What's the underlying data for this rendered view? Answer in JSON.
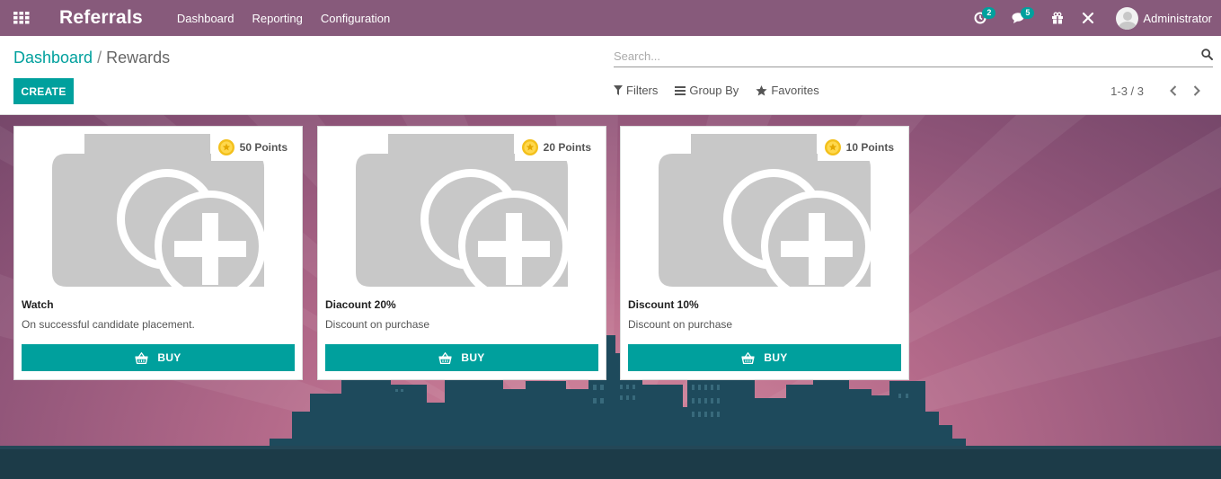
{
  "app": {
    "title": "Referrals"
  },
  "menu": [
    {
      "label": "Dashboard"
    },
    {
      "label": "Reporting"
    },
    {
      "label": "Configuration"
    }
  ],
  "systray": {
    "activity_count": "2",
    "messages_count": "5",
    "user_name": "Administrator"
  },
  "breadcrumb": {
    "parent": "Dashboard",
    "separator": "/",
    "current": "Rewards"
  },
  "buttons": {
    "create": "CREATE"
  },
  "search": {
    "placeholder": "Search..."
  },
  "filters": {
    "filters": "Filters",
    "group_by": "Group By",
    "favorites": "Favorites"
  },
  "pager": {
    "value": "1-3 / 3"
  },
  "rewards": [
    {
      "points": "50 Points",
      "name": "Watch",
      "description": "On successful candidate placement.",
      "buy_label": "BUY"
    },
    {
      "points": "20 Points",
      "name": "Diacount 20%",
      "description": "Discount on purchase",
      "buy_label": "BUY"
    },
    {
      "points": "10 Points",
      "name": "Discount 10%",
      "description": "Discount on purchase",
      "buy_label": "BUY"
    }
  ],
  "colors": {
    "navbar": "#875a7b",
    "accent": "#00a09d",
    "star": "#f3c01b",
    "city": "#1e4a5c"
  },
  "icons": {
    "apps": "grid-icon",
    "activity": "clock-icon",
    "messages": "chat-icon",
    "gift": "gift-icon",
    "debug": "tools-icon",
    "search": "search-icon",
    "buy": "basket-icon"
  }
}
